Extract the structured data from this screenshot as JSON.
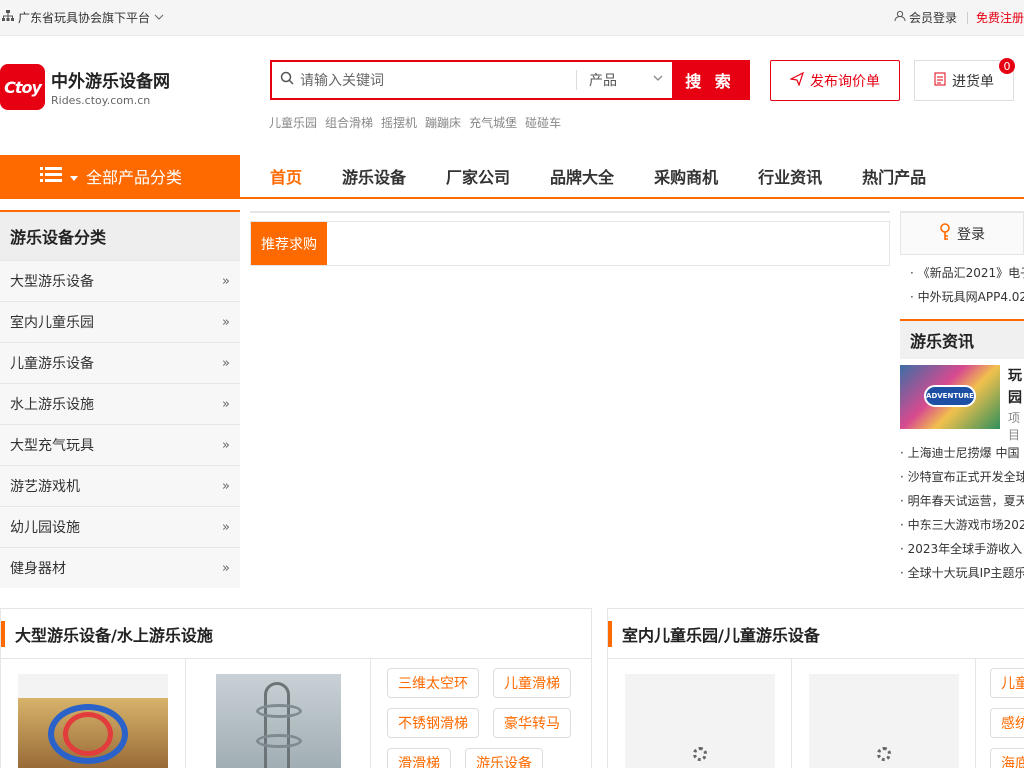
{
  "topbar": {
    "org_text": "广东省玩具协会旗下平台",
    "login": "会员登录",
    "register": "免费注册"
  },
  "logo": {
    "badge": "Ctoy",
    "name": "中外游乐设备网",
    "domain": "Rides.ctoy.com.cn"
  },
  "search": {
    "placeholder": "请输入关键词",
    "select_value": "产品",
    "button": "搜 索",
    "hotwords": [
      "儿童乐园",
      "组合滑梯",
      "摇摆机",
      "蹦蹦床",
      "充气城堡",
      "碰碰车"
    ]
  },
  "actions": {
    "inquiry": "发布询价单",
    "cart": "进货单",
    "cart_count": "0"
  },
  "nav": {
    "all_categories": "全部产品分类",
    "items": [
      "首页",
      "游乐设备",
      "厂家公司",
      "品牌大全",
      "采购商机",
      "行业资讯",
      "热门产品"
    ]
  },
  "categories": {
    "title": "游乐设备分类",
    "items": [
      "大型游乐设备",
      "室内儿童乐园",
      "儿童游乐设备",
      "水上游乐设施",
      "大型充气玩具",
      "游艺游戏机",
      "幼儿园设施",
      "健身器材"
    ]
  },
  "center": {
    "tab": "推荐求购"
  },
  "right": {
    "login": "登录",
    "notices": [
      "《新品汇2021》电子",
      "中外玩具网APP4.02"
    ],
    "news_title": "游乐资讯",
    "feature_title_1": "玩",
    "feature_title_2": "园",
    "feature_sub": "项目",
    "news": [
      "上海迪士尼捞爆 中国",
      "沙特宣布正式开发全球",
      "明年春天试运营，夏天",
      "中东三大游戏市场202",
      "2023年全球手游收入",
      "全球十大玩具IP主题乐"
    ]
  },
  "section1": {
    "title": "大型游乐设备/水上游乐设施",
    "tags": [
      "三维太空环",
      "儿童滑梯",
      "不锈钢滑梯",
      "豪华转马",
      "滑滑梯",
      "游乐设备"
    ]
  },
  "section2": {
    "title": "室内儿童乐园/儿童游乐设备",
    "tags": [
      "儿童",
      "感统",
      "海底"
    ]
  },
  "colors": {
    "brand_red": "#e60012",
    "accent_orange": "#ff6a00"
  }
}
